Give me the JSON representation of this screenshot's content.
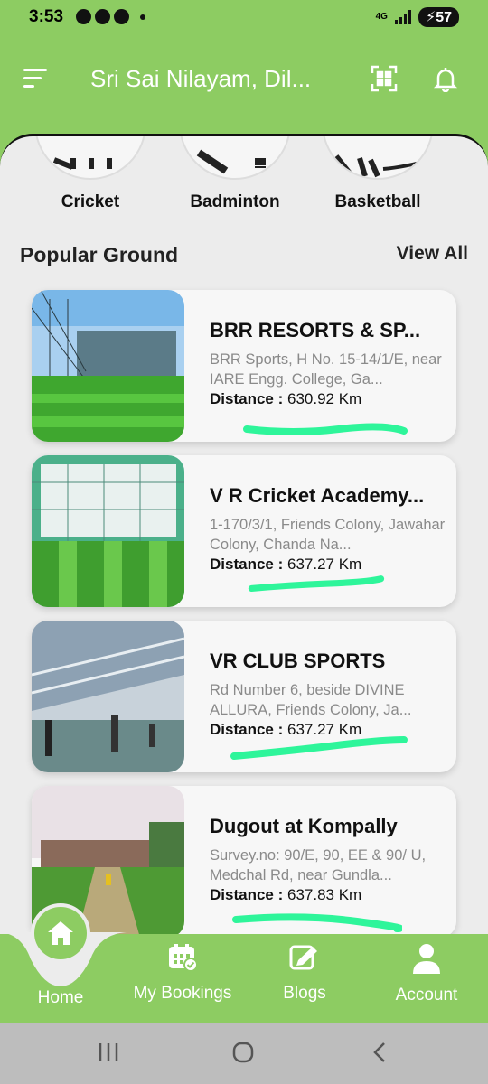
{
  "status_bar": {
    "time": "3:53",
    "network": "4G",
    "battery": "57"
  },
  "header": {
    "location": "Sri Sai Nilayam, Dil...",
    "menu_icon": "menu-icon",
    "qr_icon": "qr-scan-icon",
    "bell_icon": "bell-icon"
  },
  "categories": [
    {
      "label": "Cricket"
    },
    {
      "label": "Badminton"
    },
    {
      "label": "Basketball"
    }
  ],
  "section": {
    "title": "Popular Ground",
    "view_all": "View All"
  },
  "grounds": [
    {
      "name": "BRR RESORTS & SP...",
      "address": "BRR Sports, H No. 15-14/1/E, near IARE Engg. College, Ga...",
      "distance_label": "Distance :",
      "distance_value": "630.92 Km"
    },
    {
      "name": "V R Cricket Academy...",
      "address": "1-170/3/1, Friends Colony, Jawahar Colony, Chanda Na...",
      "distance_label": "Distance :",
      "distance_value": "637.27 Km"
    },
    {
      "name": "VR CLUB SPORTS",
      "address": "Rd Number 6, beside DIVINE ALLURA, Friends Colony, Ja...",
      "distance_label": "Distance :",
      "distance_value": "637.27 Km"
    },
    {
      "name": "Dugout at Kompally",
      "address": "Survey.no: 90/E, 90, EE & 90/ U, Medchal Rd, near Gundla...",
      "distance_label": "Distance :",
      "distance_value": "637.83 Km"
    }
  ],
  "bottom_nav": {
    "home": "Home",
    "bookings": "My Bookings",
    "blogs": "Blogs",
    "account": "Account"
  },
  "colors": {
    "brand_green": "#8dcc62",
    "scribble": "#2ef59a",
    "background": "#ececec"
  }
}
